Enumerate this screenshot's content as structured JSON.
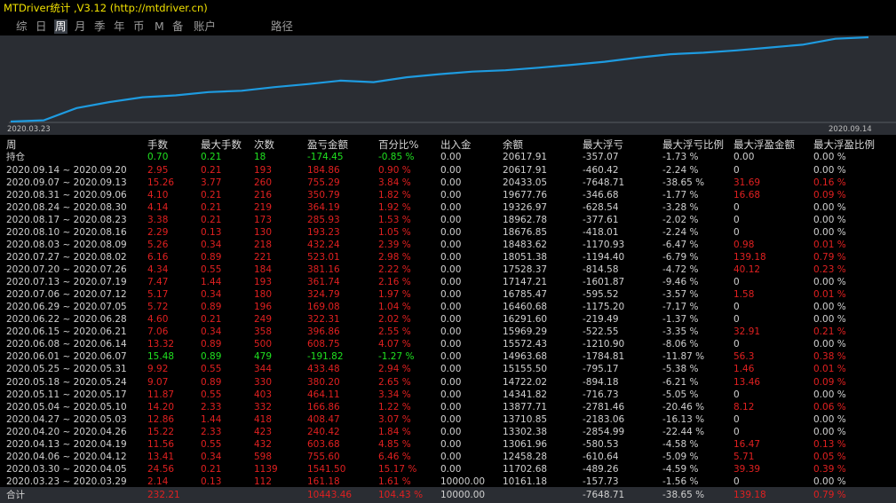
{
  "app": {
    "title": "MTDriver统计 ,V3.12 (http://mtdriver.cn)"
  },
  "tabs": [
    {
      "label": "综",
      "active": false
    },
    {
      "label": "日",
      "active": false
    },
    {
      "label": "周",
      "active": true
    },
    {
      "label": "月",
      "active": false
    },
    {
      "label": "季",
      "active": false
    },
    {
      "label": "年",
      "active": false
    },
    {
      "label": "币",
      "active": false
    },
    {
      "label": "M",
      "active": false
    },
    {
      "label": "备",
      "active": false
    },
    {
      "label": "账户",
      "active": false
    },
    {
      "label": "路径",
      "active": false
    }
  ],
  "chart": {
    "line_color": "#1e9be0",
    "x_start_label": "2020.03.23",
    "x_end_label": "2020.09.14",
    "balances": [
      10000.0,
      10161.18,
      11702.68,
      12458.28,
      13061.96,
      13302.38,
      13710.85,
      13877.71,
      14341.82,
      14722.02,
      15155.5,
      14963.68,
      15572.43,
      15969.29,
      16291.6,
      16460.68,
      16785.47,
      17147.21,
      17528.37,
      18051.38,
      18483.62,
      18676.85,
      18962.78,
      19326.97,
      19677.76,
      20433.05,
      20617.91
    ]
  },
  "colors": {
    "profit": "#e02020",
    "loss": "#20e020",
    "neutral": "#d0d0d0"
  },
  "table": {
    "headers": [
      "周",
      "手数",
      "最大手数",
      "次数",
      "盈亏金额",
      "百分比%",
      "出入金",
      "余额",
      "最大浮亏",
      "最大浮亏比例",
      "最大浮盈金额",
      "最大浮盈比例"
    ],
    "holding": {
      "label": "持仓",
      "lots": "0.70",
      "max_lots": "0.21",
      "count": "18",
      "pnl": "-174.45",
      "pct": "-0.85 %",
      "io": "0.00",
      "balance": "20617.91",
      "max_loss": "-357.07",
      "max_loss_pct": "-1.73 %",
      "max_gain": "0.00",
      "max_gain_pct": "0.00 %",
      "tone": "green"
    },
    "rows": [
      {
        "week": "2020.09.14 ~ 2020.09.20",
        "lots": "2.95",
        "max_lots": "0.21",
        "count": "193",
        "pnl": "184.86",
        "pct": "0.90 %",
        "io": "0.00",
        "balance": "20617.91",
        "max_loss": "-460.42",
        "max_loss_pct": "-2.24 %",
        "max_gain": "0",
        "max_gain_pct": "0.00 %",
        "tone": "red"
      },
      {
        "week": "2020.09.07 ~ 2020.09.13",
        "lots": "15.26",
        "max_lots": "3.77",
        "count": "260",
        "pnl": "755.29",
        "pct": "3.84 %",
        "io": "0.00",
        "balance": "20433.05",
        "max_loss": "-7648.71",
        "max_loss_pct": "-38.65 %",
        "max_gain": "31.69",
        "max_gain_pct": "0.16 %",
        "tone": "red"
      },
      {
        "week": "2020.08.31 ~ 2020.09.06",
        "lots": "4.10",
        "max_lots": "0.21",
        "count": "216",
        "pnl": "350.79",
        "pct": "1.82 %",
        "io": "0.00",
        "balance": "19677.76",
        "max_loss": "-346.68",
        "max_loss_pct": "-1.77 %",
        "max_gain": "16.68",
        "max_gain_pct": "0.09 %",
        "tone": "red"
      },
      {
        "week": "2020.08.24 ~ 2020.08.30",
        "lots": "4.14",
        "max_lots": "0.21",
        "count": "219",
        "pnl": "364.19",
        "pct": "1.92 %",
        "io": "0.00",
        "balance": "19326.97",
        "max_loss": "-628.54",
        "max_loss_pct": "-3.28 %",
        "max_gain": "0",
        "max_gain_pct": "0.00 %",
        "tone": "red"
      },
      {
        "week": "2020.08.17 ~ 2020.08.23",
        "lots": "3.38",
        "max_lots": "0.21",
        "count": "173",
        "pnl": "285.93",
        "pct": "1.53 %",
        "io": "0.00",
        "balance": "18962.78",
        "max_loss": "-377.61",
        "max_loss_pct": "-2.02 %",
        "max_gain": "0",
        "max_gain_pct": "0.00 %",
        "tone": "red"
      },
      {
        "week": "2020.08.10 ~ 2020.08.16",
        "lots": "2.29",
        "max_lots": "0.13",
        "count": "130",
        "pnl": "193.23",
        "pct": "1.05 %",
        "io": "0.00",
        "balance": "18676.85",
        "max_loss": "-418.01",
        "max_loss_pct": "-2.24 %",
        "max_gain": "0",
        "max_gain_pct": "0.00 %",
        "tone": "red"
      },
      {
        "week": "2020.08.03 ~ 2020.08.09",
        "lots": "5.26",
        "max_lots": "0.34",
        "count": "218",
        "pnl": "432.24",
        "pct": "2.39 %",
        "io": "0.00",
        "balance": "18483.62",
        "max_loss": "-1170.93",
        "max_loss_pct": "-6.47 %",
        "max_gain": "0.98",
        "max_gain_pct": "0.01 %",
        "tone": "red"
      },
      {
        "week": "2020.07.27 ~ 2020.08.02",
        "lots": "6.16",
        "max_lots": "0.89",
        "count": "221",
        "pnl": "523.01",
        "pct": "2.98 %",
        "io": "0.00",
        "balance": "18051.38",
        "max_loss": "-1194.40",
        "max_loss_pct": "-6.79 %",
        "max_gain": "139.18",
        "max_gain_pct": "0.79 %",
        "tone": "red"
      },
      {
        "week": "2020.07.20 ~ 2020.07.26",
        "lots": "4.34",
        "max_lots": "0.55",
        "count": "184",
        "pnl": "381.16",
        "pct": "2.22 %",
        "io": "0.00",
        "balance": "17528.37",
        "max_loss": "-814.58",
        "max_loss_pct": "-4.72 %",
        "max_gain": "40.12",
        "max_gain_pct": "0.23 %",
        "tone": "red"
      },
      {
        "week": "2020.07.13 ~ 2020.07.19",
        "lots": "7.47",
        "max_lots": "1.44",
        "count": "193",
        "pnl": "361.74",
        "pct": "2.16 %",
        "io": "0.00",
        "balance": "17147.21",
        "max_loss": "-1601.87",
        "max_loss_pct": "-9.46 %",
        "max_gain": "0",
        "max_gain_pct": "0.00 %",
        "tone": "red"
      },
      {
        "week": "2020.07.06 ~ 2020.07.12",
        "lots": "5.17",
        "max_lots": "0.34",
        "count": "180",
        "pnl": "324.79",
        "pct": "1.97 %",
        "io": "0.00",
        "balance": "16785.47",
        "max_loss": "-595.52",
        "max_loss_pct": "-3.57 %",
        "max_gain": "1.58",
        "max_gain_pct": "0.01 %",
        "tone": "red"
      },
      {
        "week": "2020.06.29 ~ 2020.07.05",
        "lots": "5.72",
        "max_lots": "0.89",
        "count": "196",
        "pnl": "169.08",
        "pct": "1.04 %",
        "io": "0.00",
        "balance": "16460.68",
        "max_loss": "-1175.20",
        "max_loss_pct": "-7.17 %",
        "max_gain": "0",
        "max_gain_pct": "0.00 %",
        "tone": "red"
      },
      {
        "week": "2020.06.22 ~ 2020.06.28",
        "lots": "4.60",
        "max_lots": "0.21",
        "count": "249",
        "pnl": "322.31",
        "pct": "2.02 %",
        "io": "0.00",
        "balance": "16291.60",
        "max_loss": "-219.49",
        "max_loss_pct": "-1.37 %",
        "max_gain": "0",
        "max_gain_pct": "0.00 %",
        "tone": "red"
      },
      {
        "week": "2020.06.15 ~ 2020.06.21",
        "lots": "7.06",
        "max_lots": "0.34",
        "count": "358",
        "pnl": "396.86",
        "pct": "2.55 %",
        "io": "0.00",
        "balance": "15969.29",
        "max_loss": "-522.55",
        "max_loss_pct": "-3.35 %",
        "max_gain": "32.91",
        "max_gain_pct": "0.21 %",
        "tone": "red"
      },
      {
        "week": "2020.06.08 ~ 2020.06.14",
        "lots": "13.32",
        "max_lots": "0.89",
        "count": "500",
        "pnl": "608.75",
        "pct": "4.07 %",
        "io": "0.00",
        "balance": "15572.43",
        "max_loss": "-1210.90",
        "max_loss_pct": "-8.06 %",
        "max_gain": "0",
        "max_gain_pct": "0.00 %",
        "tone": "red"
      },
      {
        "week": "2020.06.01 ~ 2020.06.07",
        "lots": "15.48",
        "max_lots": "0.89",
        "count": "479",
        "pnl": "-191.82",
        "pct": "-1.27 %",
        "io": "0.00",
        "balance": "14963.68",
        "max_loss": "-1784.81",
        "max_loss_pct": "-11.87 %",
        "max_gain": "56.3",
        "max_gain_pct": "0.38 %",
        "tone": "green"
      },
      {
        "week": "2020.05.25 ~ 2020.05.31",
        "lots": "9.92",
        "max_lots": "0.55",
        "count": "344",
        "pnl": "433.48",
        "pct": "2.94 %",
        "io": "0.00",
        "balance": "15155.50",
        "max_loss": "-795.17",
        "max_loss_pct": "-5.38 %",
        "max_gain": "1.46",
        "max_gain_pct": "0.01 %",
        "tone": "red"
      },
      {
        "week": "2020.05.18 ~ 2020.05.24",
        "lots": "9.07",
        "max_lots": "0.89",
        "count": "330",
        "pnl": "380.20",
        "pct": "2.65 %",
        "io": "0.00",
        "balance": "14722.02",
        "max_loss": "-894.18",
        "max_loss_pct": "-6.21 %",
        "max_gain": "13.46",
        "max_gain_pct": "0.09 %",
        "tone": "red"
      },
      {
        "week": "2020.05.11 ~ 2020.05.17",
        "lots": "11.87",
        "max_lots": "0.55",
        "count": "403",
        "pnl": "464.11",
        "pct": "3.34 %",
        "io": "0.00",
        "balance": "14341.82",
        "max_loss": "-716.73",
        "max_loss_pct": "-5.05 %",
        "max_gain": "0",
        "max_gain_pct": "0.00 %",
        "tone": "red"
      },
      {
        "week": "2020.05.04 ~ 2020.05.10",
        "lots": "14.20",
        "max_lots": "2.33",
        "count": "332",
        "pnl": "166.86",
        "pct": "1.22 %",
        "io": "0.00",
        "balance": "13877.71",
        "max_loss": "-2781.46",
        "max_loss_pct": "-20.46 %",
        "max_gain": "8.12",
        "max_gain_pct": "0.06 %",
        "tone": "red"
      },
      {
        "week": "2020.04.27 ~ 2020.05.03",
        "lots": "12.86",
        "max_lots": "1.44",
        "count": "418",
        "pnl": "408.47",
        "pct": "3.07 %",
        "io": "0.00",
        "balance": "13710.85",
        "max_loss": "-2183.06",
        "max_loss_pct": "-16.13 %",
        "max_gain": "0",
        "max_gain_pct": "0.00 %",
        "tone": "red"
      },
      {
        "week": "2020.04.20 ~ 2020.04.26",
        "lots": "15.22",
        "max_lots": "2.33",
        "count": "423",
        "pnl": "240.42",
        "pct": "1.84 %",
        "io": "0.00",
        "balance": "13302.38",
        "max_loss": "-2854.99",
        "max_loss_pct": "-22.44 %",
        "max_gain": "0",
        "max_gain_pct": "0.00 %",
        "tone": "red"
      },
      {
        "week": "2020.04.13 ~ 2020.04.19",
        "lots": "11.56",
        "max_lots": "0.55",
        "count": "432",
        "pnl": "603.68",
        "pct": "4.85 %",
        "io": "0.00",
        "balance": "13061.96",
        "max_loss": "-580.53",
        "max_loss_pct": "-4.58 %",
        "max_gain": "16.47",
        "max_gain_pct": "0.13 %",
        "tone": "red"
      },
      {
        "week": "2020.04.06 ~ 2020.04.12",
        "lots": "13.41",
        "max_lots": "0.34",
        "count": "598",
        "pnl": "755.60",
        "pct": "6.46 %",
        "io": "0.00",
        "balance": "12458.28",
        "max_loss": "-610.64",
        "max_loss_pct": "-5.09 %",
        "max_gain": "5.71",
        "max_gain_pct": "0.05 %",
        "tone": "red"
      },
      {
        "week": "2020.03.30 ~ 2020.04.05",
        "lots": "24.56",
        "max_lots": "0.21",
        "count": "1139",
        "pnl": "1541.50",
        "pct": "15.17 %",
        "io": "0.00",
        "balance": "11702.68",
        "max_loss": "-489.26",
        "max_loss_pct": "-4.59 %",
        "max_gain": "39.39",
        "max_gain_pct": "0.39 %",
        "tone": "red"
      },
      {
        "week": "2020.03.23 ~ 2020.03.29",
        "lots": "2.14",
        "max_lots": "0.13",
        "count": "112",
        "pnl": "161.18",
        "pct": "1.61 %",
        "io": "10000.00",
        "balance": "10161.18",
        "max_loss": "-157.73",
        "max_loss_pct": "-1.56 %",
        "max_gain": "0",
        "max_gain_pct": "0.00 %",
        "tone": "red"
      }
    ],
    "total": {
      "label": "合计",
      "lots": "232.21",
      "max_lots": "",
      "count": "",
      "pnl": "10443.46",
      "pct": "104.43 %",
      "io": "10000.00",
      "balance": "",
      "max_loss": "-7648.71",
      "max_loss_pct": "-38.65 %",
      "max_gain": "139.18",
      "max_gain_pct": "0.79 %",
      "tone": "red"
    }
  }
}
